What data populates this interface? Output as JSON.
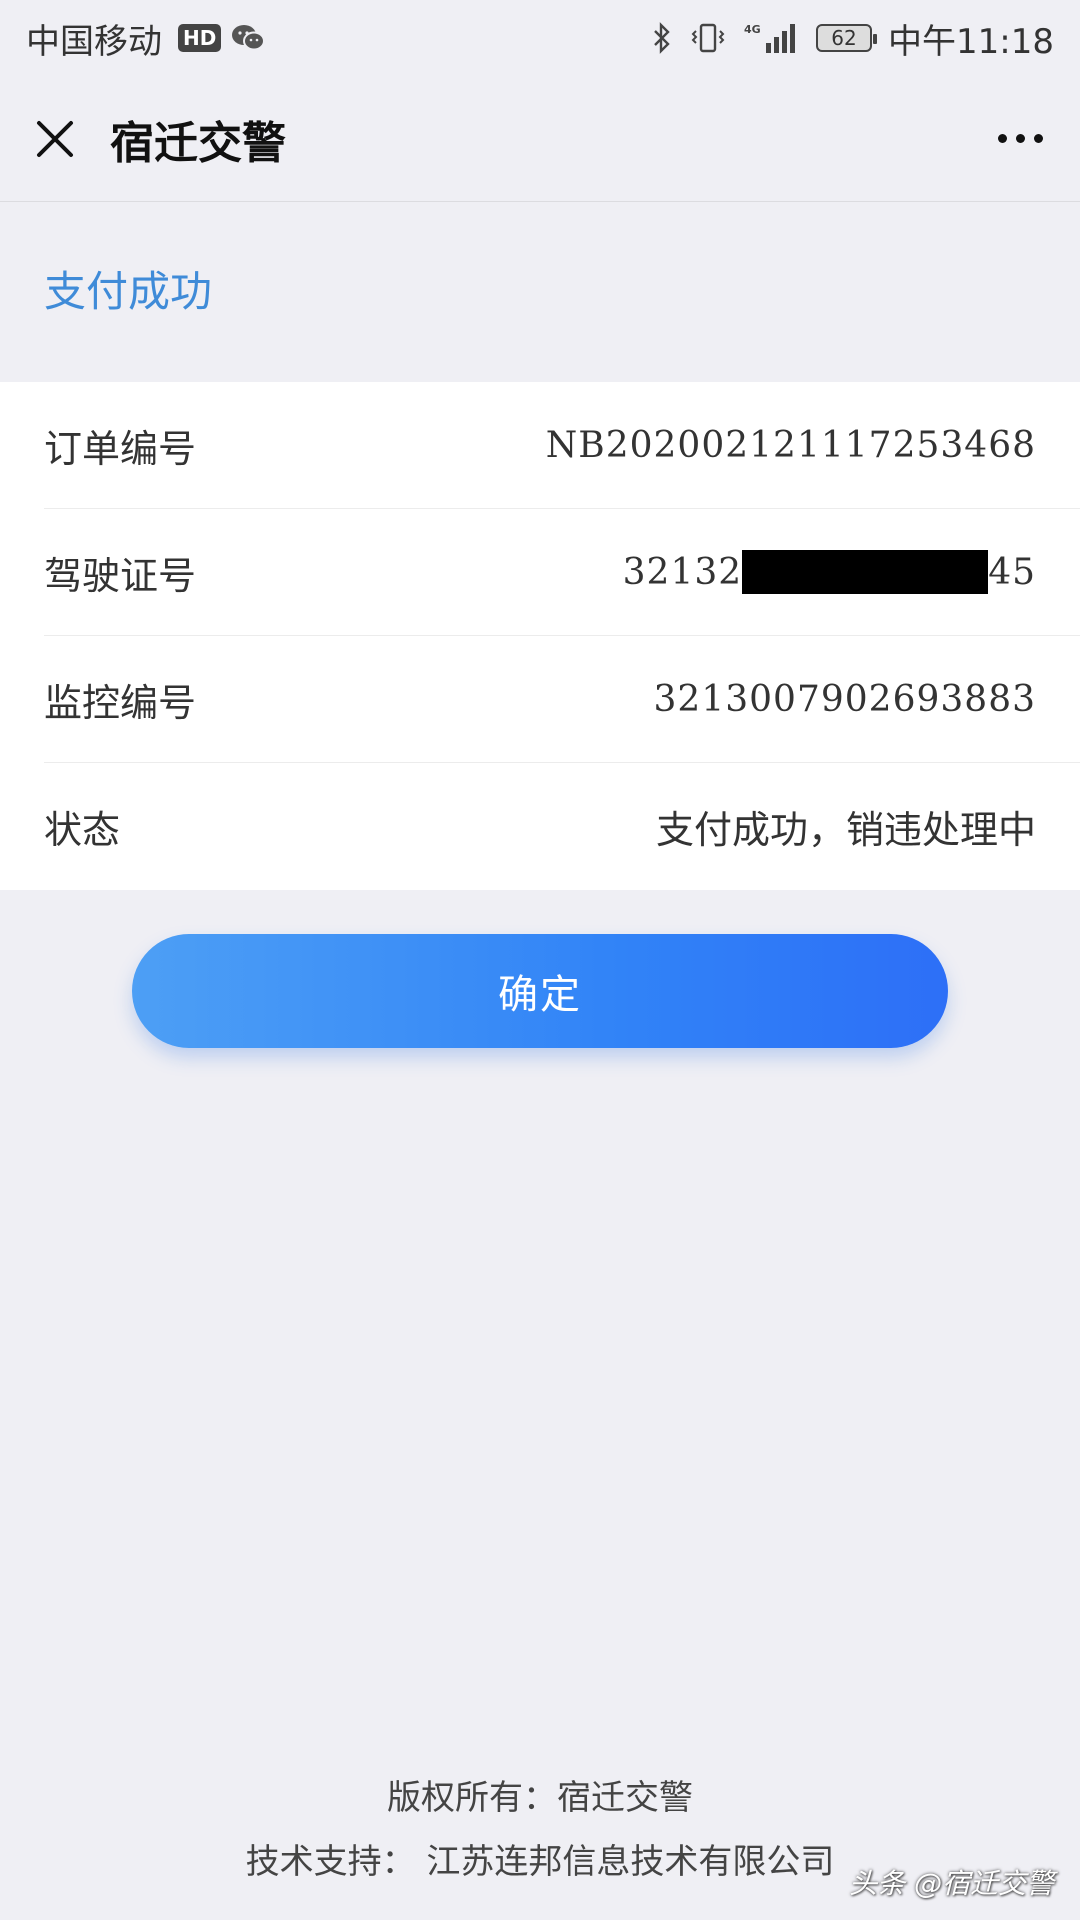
{
  "status_bar": {
    "carrier": "中国移动",
    "hd_badge": "HD",
    "network": "4G",
    "battery": "62",
    "time": "中午11:18",
    "icons": [
      "wechat-icon",
      "bluetooth-icon",
      "vibrate-icon",
      "signal-icon",
      "battery-icon"
    ]
  },
  "nav": {
    "title": "宿迁交警",
    "icons": [
      "close-icon",
      "more-icon"
    ]
  },
  "result": {
    "title": "支付成功",
    "accent_color": "#3f8bd8"
  },
  "info": {
    "rows": [
      {
        "label": "订单编号",
        "value": "NB20200212111725346​8"
      },
      {
        "label": "驾驶证号",
        "value_prefix": "32132",
        "value_suffix": "45"
      },
      {
        "label": "监控编号",
        "value": "3213007902693883"
      },
      {
        "label": "状态",
        "value": "支付成功，销违处理中"
      }
    ]
  },
  "confirm": {
    "label": "确定",
    "gradient": [
      "#4d9ff5",
      "#2d6ff7"
    ]
  },
  "footer": {
    "copyright": "版权所有：宿迁交警",
    "support": "技术支持：  江苏连邦信息技术有限公司"
  },
  "watermark": "头条 @宿迁交警"
}
